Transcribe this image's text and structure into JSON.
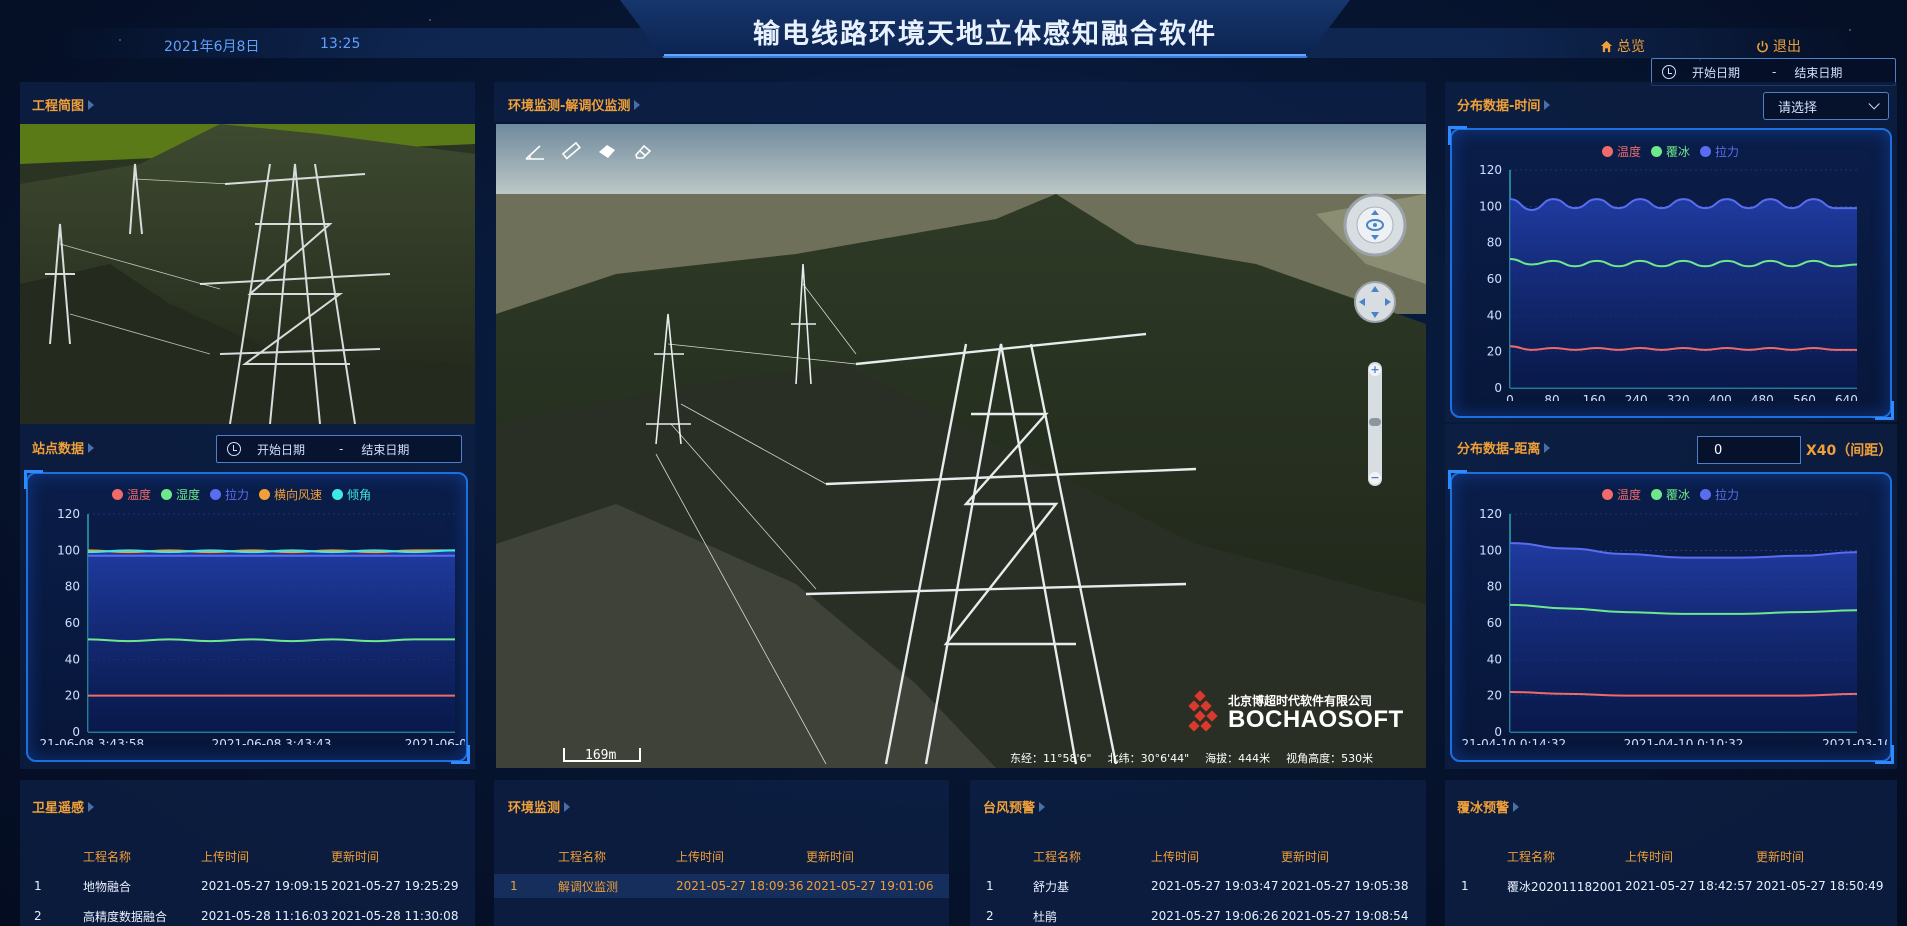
{
  "header": {
    "title": "输电线路环境天地立体感知融合软件",
    "date": "2021年6月8日",
    "time": "13:25",
    "home_label": "总览",
    "exit_label": "退出"
  },
  "date_range": {
    "start_label": "开始日期",
    "separator": "-",
    "end_label": "结束日期"
  },
  "panels": {
    "overview_title": "工程简图",
    "station_title": "站点数据",
    "monitor_title": "环境监测-解调仪监测",
    "dist_time_title": "分布数据-时间",
    "dist_dist_title": "分布数据-距离",
    "satellite_title": "卫星遥感",
    "env_title": "环境监测",
    "typhoon_title": "台风预警",
    "ice_title": "覆冰预警"
  },
  "controls": {
    "select_placeholder": "请选择",
    "distance_value": "0",
    "distance_unit": "X40（间距）"
  },
  "map": {
    "scale": "169m",
    "coords": [
      "东经：11°58'6\"",
      "北纬：30°6'44\"",
      "海拔：444米",
      "视角高度：530米"
    ],
    "logo_cn": "北京博超时代软件有限公司",
    "logo_en": "BOCHAOSOFT"
  },
  "colors": {
    "temp": "#f06a6a",
    "humid": "#6ee88a",
    "tension": "#5a6cf0",
    "wind": "#f0a038",
    "tilt": "#3ee8e8",
    "accent": "#f0a038"
  },
  "tables": {
    "headers": [
      "工程名称",
      "上传时间",
      "更新时间"
    ],
    "satellite": [
      [
        "1",
        "地物融合",
        "2021-05-27 19:09:15",
        "2021-05-27 19:25:29"
      ],
      [
        "2",
        "高精度数据融合",
        "2021-05-28 11:16:03",
        "2021-05-28 11:30:08"
      ]
    ],
    "env": [
      [
        "1",
        "解调仪监测",
        "2021-05-27 18:09:36",
        "2021-05-27 19:01:06"
      ]
    ],
    "typhoon": [
      [
        "1",
        "舒力基",
        "2021-05-27 19:03:47",
        "2021-05-27 19:05:38"
      ],
      [
        "2",
        "杜鹃",
        "2021-05-27 19:06:26",
        "2021-05-27 19:08:54"
      ]
    ],
    "ice": [
      [
        "1",
        "覆冰202011182001",
        "2021-05-27 18:42:57",
        "2021-05-27 18:50:49"
      ]
    ]
  },
  "chart_data": [
    {
      "type": "area",
      "id": "station",
      "legend": [
        "温度",
        "湿度",
        "拉力",
        "横向风速",
        "倾角"
      ],
      "ylim": [
        0,
        120
      ],
      "yticks": [
        0,
        20,
        40,
        60,
        80,
        100,
        120
      ],
      "xticks": [
        "021-06-08 3:43:58",
        "2021-06-08 3:43:43",
        "2021-06-08 3:43"
      ],
      "series": [
        {
          "name": "温度",
          "values": [
            20,
            20,
            20,
            20,
            20,
            20,
            20,
            20,
            20,
            20
          ]
        },
        {
          "name": "湿度",
          "values": [
            51,
            50,
            51,
            50,
            51,
            50,
            51,
            50,
            51,
            51
          ]
        },
        {
          "name": "拉力",
          "values": [
            97,
            97,
            97,
            97,
            97,
            97,
            97,
            97,
            97,
            97
          ]
        },
        {
          "name": "横向风速",
          "values": [
            100,
            99,
            100,
            99,
            100,
            99,
            100,
            99,
            100,
            100
          ]
        },
        {
          "name": "倾角",
          "values": [
            99,
            100,
            99,
            100,
            99,
            100,
            99,
            100,
            99,
            100
          ]
        }
      ]
    },
    {
      "type": "area",
      "id": "dist_time",
      "legend": [
        "温度",
        "覆冰",
        "拉力"
      ],
      "ylim": [
        0,
        120
      ],
      "yticks": [
        0,
        20,
        40,
        60,
        80,
        100,
        120
      ],
      "xlim": [
        0,
        660
      ],
      "xticks": [
        "0",
        "80",
        "160",
        "240",
        "320",
        "400",
        "480",
        "560",
        "640"
      ],
      "series": [
        {
          "name": "温度",
          "values": [
            23,
            21,
            22,
            21,
            22,
            21,
            22,
            21,
            22,
            21,
            22,
            21,
            22,
            21,
            22,
            21,
            21
          ]
        },
        {
          "name": "覆冰",
          "values": [
            71,
            68,
            70,
            67,
            70,
            67,
            70,
            67,
            70,
            67,
            70,
            67,
            70,
            67,
            70,
            67,
            68
          ]
        },
        {
          "name": "拉力",
          "values": [
            104,
            98,
            104,
            99,
            104,
            99,
            104,
            99,
            104,
            99,
            104,
            99,
            104,
            99,
            104,
            99,
            99
          ]
        }
      ]
    },
    {
      "type": "area",
      "id": "dist_dist",
      "legend": [
        "温度",
        "覆冰",
        "拉力"
      ],
      "ylim": [
        0,
        120
      ],
      "yticks": [
        0,
        20,
        40,
        60,
        80,
        100,
        120
      ],
      "xticks": [
        "021-04-10 0:14:32",
        "2021-04-10 0:10:32",
        "2021-03-10"
      ],
      "series": [
        {
          "name": "温度",
          "values": [
            22,
            21,
            20,
            20,
            20,
            20,
            21
          ]
        },
        {
          "name": "覆冰",
          "values": [
            70,
            68,
            66,
            65,
            65,
            66,
            67
          ]
        },
        {
          "name": "拉力",
          "values": [
            104,
            101,
            98,
            96,
            96,
            97,
            99
          ]
        }
      ]
    }
  ]
}
